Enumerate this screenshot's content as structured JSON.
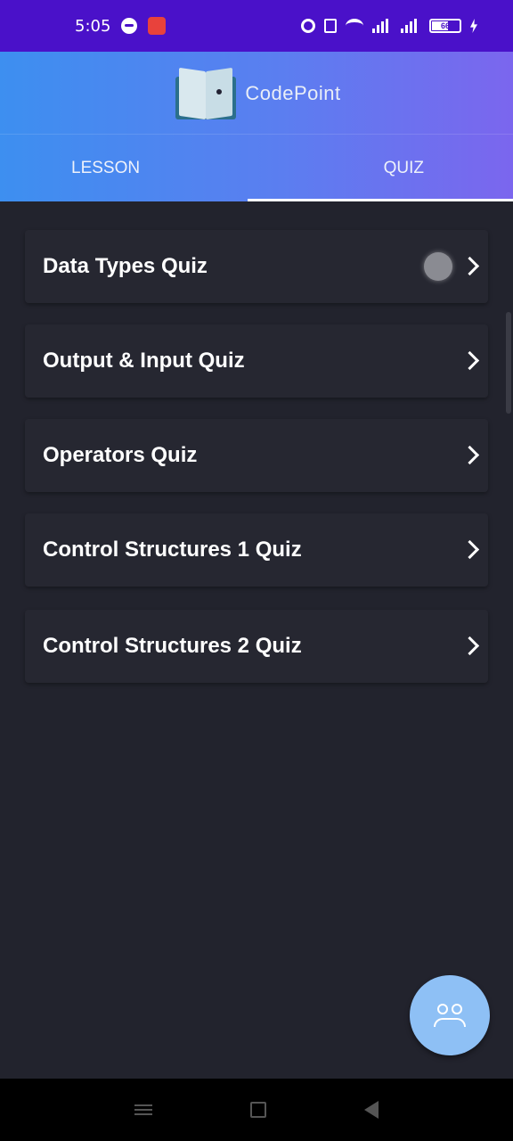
{
  "status_bar": {
    "time": "5:05",
    "battery": "66"
  },
  "header": {
    "app_name": "CodePoint",
    "tabs": [
      {
        "label": "LESSON",
        "active": false
      },
      {
        "label": "QUIZ",
        "active": true
      }
    ]
  },
  "quizzes": [
    {
      "label": "Data Types Quiz"
    },
    {
      "label": "Output & Input Quiz"
    },
    {
      "label": "Operators Quiz"
    },
    {
      "label": "Control Structures 1 Quiz"
    },
    {
      "label": "Control Structures 2 Quiz"
    }
  ],
  "fab": {
    "icon": "people-icon"
  },
  "colors": {
    "status_bar": "#4a11c9",
    "header_gradient_start": "#3d8ff0",
    "header_gradient_end": "#7b66ee",
    "background": "#22232d",
    "card": "#262731",
    "fab": "#8ec0f5"
  }
}
